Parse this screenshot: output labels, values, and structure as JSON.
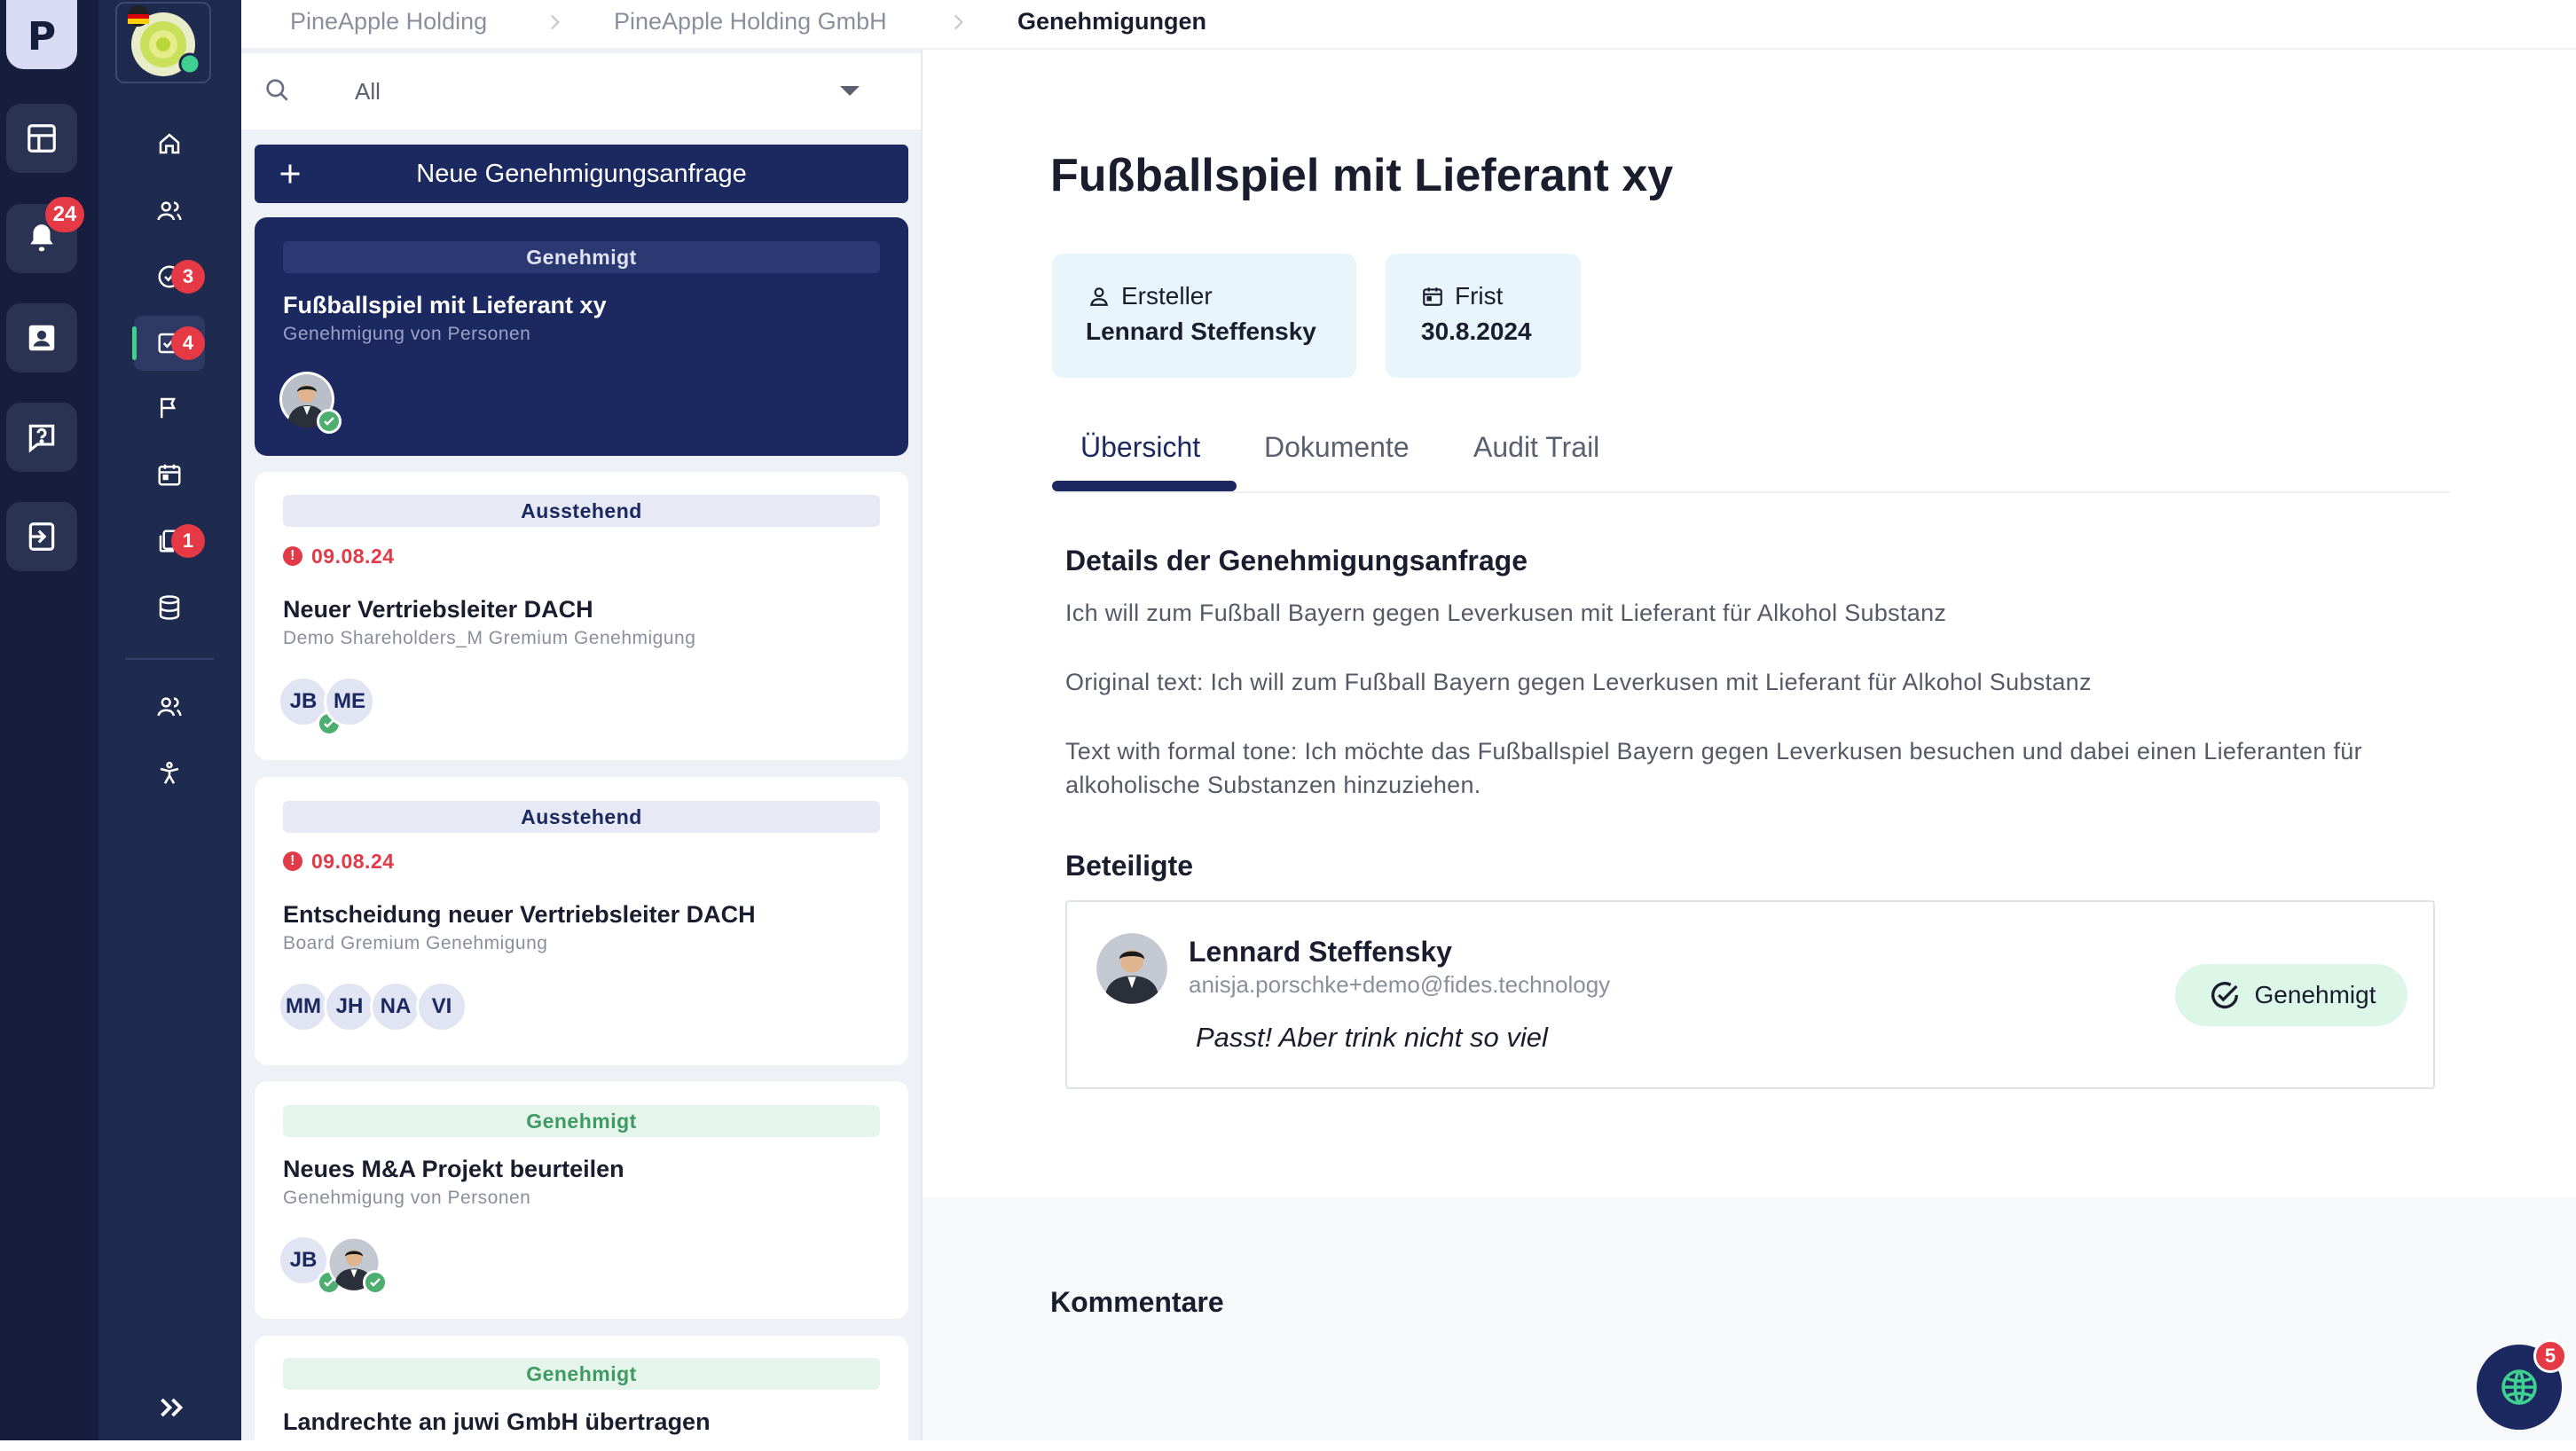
{
  "rail": {
    "logo_letter": "P",
    "notifications_count": "24"
  },
  "nav": {
    "approvals_badge": "3",
    "active_badge": "4",
    "documents_badge": "1"
  },
  "breadcrumb": {
    "items": [
      "PineApple Holding",
      "PineApple Holding GmbH",
      "Genehmigungen"
    ]
  },
  "filter": {
    "value": "All"
  },
  "new_request_label": "Neue Genehmigungsanfrage",
  "cards": [
    {
      "status": "Genehmigt",
      "title": "Fußballspiel mit Lieferant xy",
      "subtitle": "Genehmigung von Personen"
    },
    {
      "status": "Ausstehend",
      "due": "09.08.24",
      "title": "Neuer Vertriebsleiter DACH",
      "subtitle": "Demo Shareholders_M Gremium Genehmigung",
      "initials": [
        "JB",
        "ME"
      ]
    },
    {
      "status": "Ausstehend",
      "due": "09.08.24",
      "title": "Entscheidung neuer Vertriebsleiter DACH",
      "subtitle": "Board Gremium Genehmigung",
      "initials": [
        "MM",
        "JH",
        "NA",
        "VI"
      ]
    },
    {
      "status": "Genehmigt",
      "title": "Neues M&A Projekt beurteilen",
      "subtitle": "Genehmigung von Personen",
      "initials": [
        "JB"
      ]
    },
    {
      "status": "Genehmigt",
      "title": "Landrechte an juwi GmbH übertragen"
    }
  ],
  "detail": {
    "title": "Fußballspiel mit Lieferant xy",
    "creator_label": "Ersteller",
    "creator_name": "Lennard Steffensky",
    "deadline_label": "Frist",
    "deadline_value": "30.8.2024",
    "tabs": [
      "Übersicht",
      "Dokumente",
      "Audit Trail"
    ],
    "section_title": "Details der Genehmigungsanfrage",
    "paragraph_1": "Ich will zum Fußball Bayern gegen Leverkusen mit Lieferant für Alkohol Substanz",
    "paragraph_2": "Original text: Ich will zum Fußball Bayern gegen Leverkusen mit Lieferant für Alkohol Substanz",
    "paragraph_3": "Text with formal tone: Ich möchte das Fußballspiel Bayern gegen Leverkusen besuchen und dabei einen Lieferanten für alkoholische Substanzen hinzuziehen.",
    "participants_title": "Beteiligte",
    "participant": {
      "name": "Lennard Steffensky",
      "email": "anisja.porschke+demo@fides.technology",
      "comment": "Passt! Aber trink nicht so viel",
      "status": "Genehmigt"
    },
    "comments_title": "Kommentare"
  },
  "fab": {
    "badge": "5"
  },
  "colors": {
    "navy": "#1c2860",
    "approved_green": "#4caf70",
    "pending_bg": "#e7eaf4",
    "alert_red": "#e23a48"
  }
}
